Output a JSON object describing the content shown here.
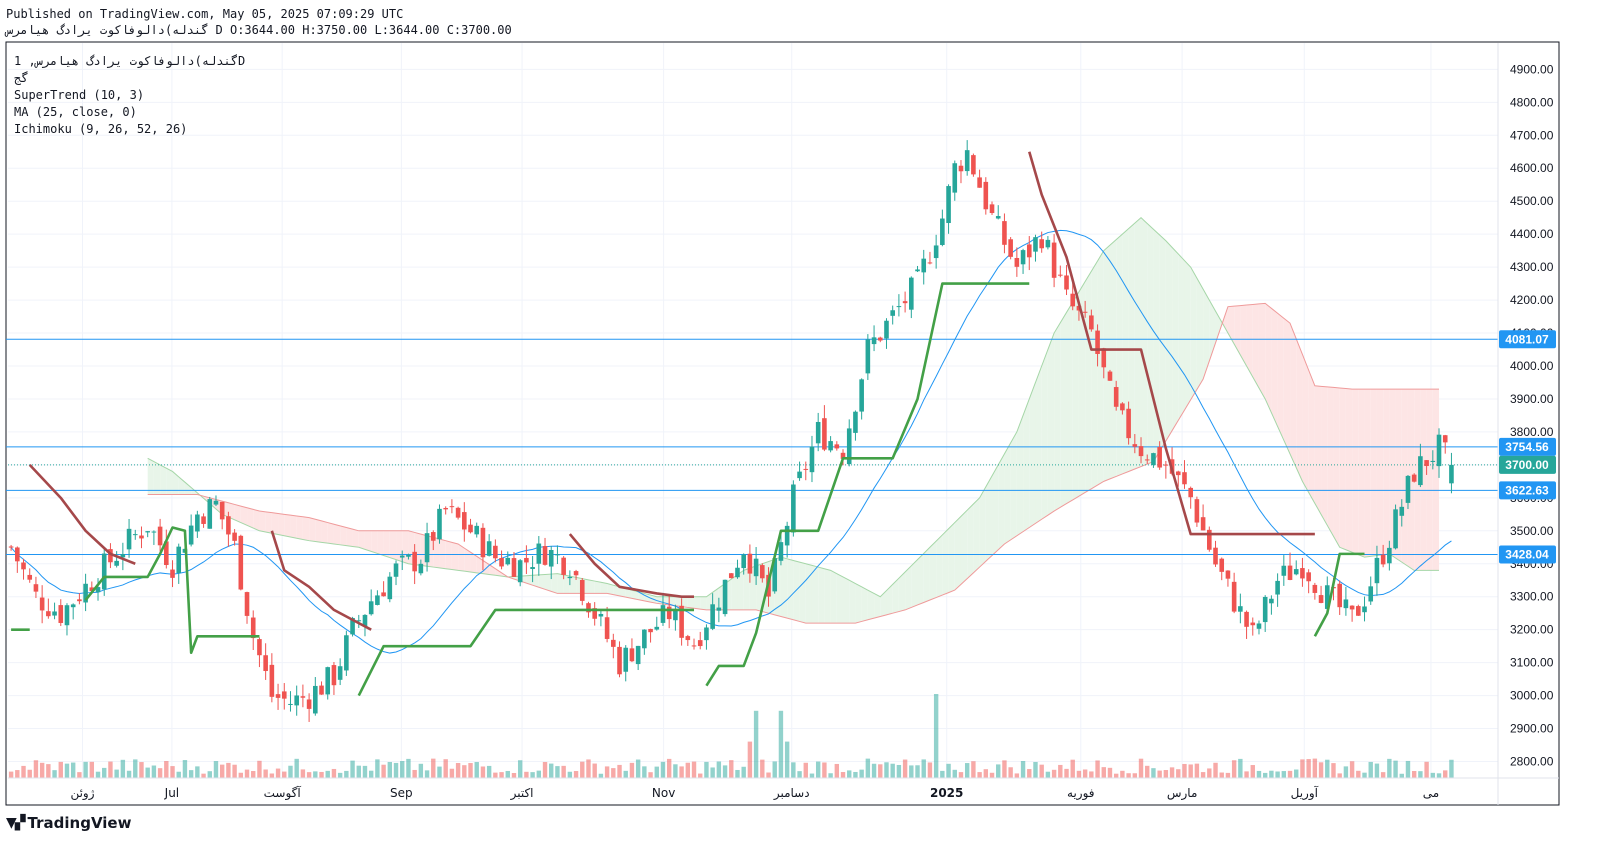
{
  "header": {
    "published": "Published on TradingView.com, May 05, 2025 07:09:29 UTC",
    "ohlc": "گندله)دالوفاكوت يرادگ هيامرس D O:3644.00 H:3750.00 L:3644.00 C:3700.00"
  },
  "legend": {
    "symbol": "گندله)دالوفاكوت يرادگ هيامرس, 1D",
    "line2": "گج",
    "supertrend": "SuperTrend (10, 3)",
    "ma": "MA (25, close, 0)",
    "ichimoku": "Ichimoku (9, 26, 52, 26)"
  },
  "brand": {
    "name": "TradingView",
    "icon": "tradingview-logo-icon"
  },
  "colors": {
    "up": "#26a69a",
    "down": "#ef5350",
    "supertrend_up": "#43a047",
    "supertrend_down": "#a5484a",
    "ma": "#2196f3",
    "hline": "#2196f3",
    "kumo_bull": "#e8f5e9",
    "kumo_bear": "#fde5e5"
  },
  "chart_data": {
    "type": "candlestick",
    "timeframe": "1D",
    "ylim": [
      2750,
      4980
    ],
    "y_ticks": [
      2800,
      2900,
      3000,
      3100,
      3200,
      3300,
      3400,
      3500,
      3600,
      3700,
      3800,
      3900,
      4000,
      4100,
      4200,
      4300,
      4400,
      4500,
      4600,
      4700,
      4800,
      4900
    ],
    "x_labels": [
      {
        "label": "ژوئن",
        "pos": 0.05
      },
      {
        "label": "Jul",
        "pos": 0.11
      },
      {
        "label": "آگوست",
        "pos": 0.184
      },
      {
        "label": "Sep",
        "pos": 0.264
      },
      {
        "label": "اکتبر",
        "pos": 0.345
      },
      {
        "label": "Nov",
        "pos": 0.44
      },
      {
        "label": "دسامبر",
        "pos": 0.526
      },
      {
        "label": "2025",
        "pos": 0.63
      },
      {
        "label": "فوریه",
        "pos": 0.72
      },
      {
        "label": "مارس",
        "pos": 0.788
      },
      {
        "label": "آوریل",
        "pos": 0.87
      },
      {
        "label": "می",
        "pos": 0.955
      }
    ],
    "horizontal_lines": [
      4081.07,
      3754.56,
      3622.63,
      3428.04
    ],
    "price_labels": [
      {
        "value": 4081.07,
        "text": "4081.07"
      },
      {
        "value": 3754.56,
        "text": "3754.56"
      },
      {
        "value": 3700.0,
        "text": "3700.00"
      },
      {
        "value": 3622.63,
        "text": "3622.63"
      },
      {
        "value": 3428.04,
        "text": "3428.04"
      }
    ],
    "last_close": 3700.0,
    "price_keys": [
      [
        0,
        3450
      ],
      [
        4,
        3300
      ],
      [
        8,
        3250
      ],
      [
        13,
        3350
      ],
      [
        18,
        3450
      ],
      [
        22,
        3520
      ],
      [
        26,
        3400
      ],
      [
        30,
        3550
      ],
      [
        33,
        3580
      ],
      [
        36,
        3450
      ],
      [
        39,
        3180
      ],
      [
        42,
        3000
      ],
      [
        45,
        2980
      ],
      [
        48,
        3000
      ],
      [
        52,
        3060
      ],
      [
        55,
        3200
      ],
      [
        58,
        3290
      ],
      [
        62,
        3380
      ],
      [
        66,
        3420
      ],
      [
        70,
        3560
      ],
      [
        74,
        3500
      ],
      [
        78,
        3420
      ],
      [
        82,
        3400
      ],
      [
        86,
        3440
      ],
      [
        90,
        3400
      ],
      [
        94,
        3250
      ],
      [
        98,
        3100
      ],
      [
        102,
        3180
      ],
      [
        106,
        3250
      ],
      [
        110,
        3160
      ],
      [
        114,
        3300
      ],
      [
        118,
        3450
      ],
      [
        122,
        3300
      ],
      [
        126,
        3600
      ],
      [
        130,
        3800
      ],
      [
        134,
        3750
      ],
      [
        138,
        4050
      ],
      [
        142,
        4150
      ],
      [
        146,
        4250
      ],
      [
        150,
        4450
      ],
      [
        152,
        4600
      ],
      [
        154,
        4650
      ],
      [
        158,
        4450
      ],
      [
        162,
        4300
      ],
      [
        166,
        4400
      ],
      [
        170,
        4200
      ],
      [
        174,
        4100
      ],
      [
        178,
        3850
      ],
      [
        182,
        3750
      ],
      [
        186,
        3700
      ],
      [
        190,
        3600
      ],
      [
        194,
        3400
      ],
      [
        198,
        3250
      ],
      [
        200,
        3180
      ],
      [
        204,
        3350
      ],
      [
        208,
        3400
      ],
      [
        212,
        3300
      ],
      [
        216,
        3230
      ],
      [
        218,
        3300
      ],
      [
        222,
        3480
      ],
      [
        226,
        3680
      ],
      [
        230,
        3750
      ],
      [
        232,
        3700
      ]
    ],
    "supertrend": {
      "up_segments": [
        [
          [
            0,
            3200
          ],
          [
            3,
            3200
          ]
        ],
        [
          [
            12,
            3290
          ],
          [
            15,
            3360
          ],
          [
            22,
            3360
          ],
          [
            24,
            3430
          ],
          [
            26,
            3510
          ],
          [
            28,
            3500
          ],
          [
            29,
            3130
          ],
          [
            30,
            3180
          ],
          [
            40,
            3180
          ]
        ],
        [
          [
            56,
            3000
          ],
          [
            60,
            3150
          ],
          [
            74,
            3150
          ],
          [
            78,
            3260
          ],
          [
            84,
            3260
          ],
          [
            110,
            3260
          ]
        ],
        [
          [
            112,
            3030
          ],
          [
            114,
            3090
          ],
          [
            118,
            3090
          ],
          [
            120,
            3190
          ],
          [
            124,
            3500
          ],
          [
            130,
            3500
          ],
          [
            134,
            3720
          ],
          [
            142,
            3720
          ],
          [
            146,
            3900
          ],
          [
            150,
            4250
          ],
          [
            164,
            4250
          ]
        ],
        [
          [
            210,
            3180
          ],
          [
            212,
            3250
          ],
          [
            214,
            3430
          ],
          [
            218,
            3430
          ]
        ]
      ],
      "down_segments": [
        [
          [
            3,
            3700
          ],
          [
            8,
            3600
          ],
          [
            12,
            3500
          ],
          [
            16,
            3430
          ],
          [
            20,
            3400
          ]
        ],
        [
          [
            42,
            3500
          ],
          [
            44,
            3380
          ],
          [
            48,
            3330
          ],
          [
            52,
            3260
          ],
          [
            56,
            3220
          ],
          [
            58,
            3200
          ]
        ],
        [
          [
            90,
            3490
          ],
          [
            94,
            3400
          ],
          [
            98,
            3330
          ],
          [
            104,
            3310
          ],
          [
            108,
            3300
          ],
          [
            110,
            3300
          ]
        ],
        [
          [
            164,
            4650
          ],
          [
            166,
            4520
          ],
          [
            170,
            4330
          ],
          [
            174,
            4050
          ],
          [
            182,
            4050
          ],
          [
            186,
            3750
          ],
          [
            190,
            3490
          ],
          [
            210,
            3490
          ]
        ]
      ]
    },
    "ma_period": 25,
    "ichimoku": {
      "senkou_a_keys": [
        [
          22,
          3720
        ],
        [
          26,
          3680
        ],
        [
          34,
          3550
        ],
        [
          40,
          3500
        ],
        [
          48,
          3470
        ],
        [
          56,
          3450
        ],
        [
          64,
          3400
        ],
        [
          72,
          3380
        ],
        [
          80,
          3360
        ],
        [
          88,
          3370
        ],
        [
          96,
          3340
        ],
        [
          104,
          3300
        ],
        [
          112,
          3300
        ],
        [
          118,
          3380
        ],
        [
          124,
          3420
        ],
        [
          132,
          3380
        ],
        [
          140,
          3300
        ],
        [
          148,
          3450
        ],
        [
          156,
          3600
        ],
        [
          162,
          3800
        ],
        [
          168,
          4100
        ],
        [
          176,
          4350
        ],
        [
          182,
          4450
        ],
        [
          186,
          4380
        ],
        [
          190,
          4300
        ],
        [
          196,
          4100
        ],
        [
          202,
          3900
        ],
        [
          208,
          3650
        ],
        [
          214,
          3450
        ],
        [
          218,
          3420
        ],
        [
          222,
          3430
        ],
        [
          226,
          3380
        ],
        [
          230,
          3380
        ]
      ],
      "senkou_b_keys": [
        [
          22,
          3610
        ],
        [
          30,
          3610
        ],
        [
          40,
          3560
        ],
        [
          48,
          3540
        ],
        [
          56,
          3500
        ],
        [
          64,
          3500
        ],
        [
          72,
          3460
        ],
        [
          80,
          3360
        ],
        [
          88,
          3310
        ],
        [
          96,
          3310
        ],
        [
          104,
          3280
        ],
        [
          112,
          3260
        ],
        [
          120,
          3260
        ],
        [
          128,
          3220
        ],
        [
          136,
          3220
        ],
        [
          144,
          3260
        ],
        [
          152,
          3320
        ],
        [
          160,
          3460
        ],
        [
          168,
          3560
        ],
        [
          176,
          3650
        ],
        [
          184,
          3710
        ],
        [
          192,
          3960
        ],
        [
          196,
          4180
        ],
        [
          202,
          4190
        ],
        [
          206,
          4130
        ],
        [
          210,
          3940
        ],
        [
          216,
          3930
        ],
        [
          222,
          3930
        ],
        [
          230,
          3930
        ]
      ]
    },
    "ohlc": {
      "open": 3644.0,
      "high": 3750.0,
      "low": 3644.0,
      "close": 3700.0
    }
  }
}
